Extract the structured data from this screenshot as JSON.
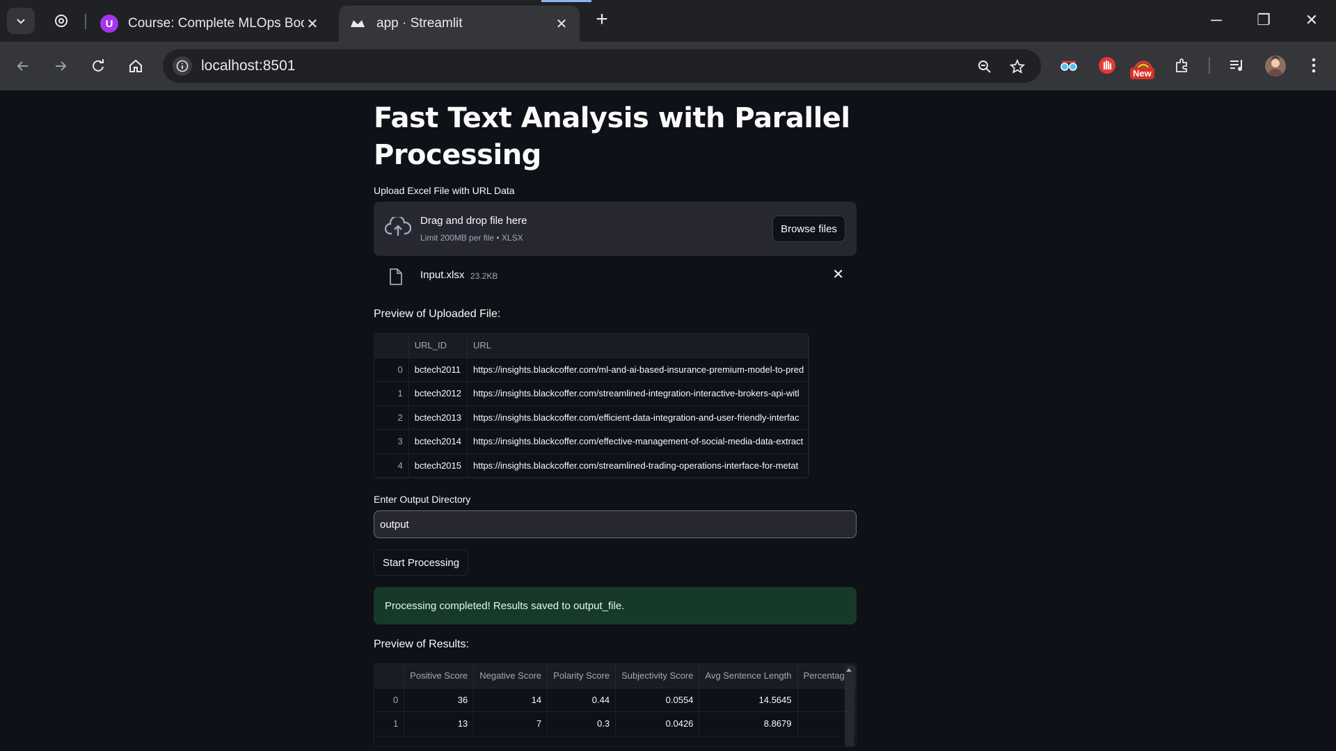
{
  "browser": {
    "tabs": [
      {
        "title": "Course: Complete MLOps Bootc",
        "favicon": "udemy-icon"
      },
      {
        "title": "app · Streamlit",
        "favicon": "streamlit-icon"
      }
    ],
    "address": "localhost:8501",
    "extensions": [
      "new-badge-extension"
    ],
    "new_badge": "New"
  },
  "page": {
    "title": "Fast Text Analysis with Parallel Processing",
    "upload_label": "Upload Excel File with URL Data",
    "dropzone": {
      "main": "Drag and drop file here",
      "sub": "Limit 200MB per file • XLSX",
      "browse": "Browse files"
    },
    "file": {
      "name": "Input.xlsx",
      "size": "23.2KB"
    },
    "preview_heading": "Preview of Uploaded File:",
    "preview_table": {
      "columns": [
        "",
        "URL_ID",
        "URL"
      ],
      "rows": [
        [
          "0",
          "bctech2011",
          "https://insights.blackcoffer.com/ml-and-ai-based-insurance-premium-model-to-pred"
        ],
        [
          "1",
          "bctech2012",
          "https://insights.blackcoffer.com/streamlined-integration-interactive-brokers-api-witl"
        ],
        [
          "2",
          "bctech2013",
          "https://insights.blackcoffer.com/efficient-data-integration-and-user-friendly-interfac"
        ],
        [
          "3",
          "bctech2014",
          "https://insights.blackcoffer.com/effective-management-of-social-media-data-extract"
        ],
        [
          "4",
          "bctech2015",
          "https://insights.blackcoffer.com/streamlined-trading-operations-interface-for-metat"
        ]
      ]
    },
    "output_label": "Enter Output Directory",
    "output_value": "output",
    "start_button": "Start Processing",
    "success_message": "Processing completed! Results saved to output_file.",
    "results_heading": "Preview of Results:",
    "results_table": {
      "columns": [
        "",
        "Positive Score",
        "Negative Score",
        "Polarity Score",
        "Subjectivity Score",
        "Avg Sentence Length",
        "Percentage"
      ],
      "rows": [
        [
          "0",
          "36",
          "14",
          "0.44",
          "0.0554",
          "14.5645",
          ""
        ],
        [
          "1",
          "13",
          "7",
          "0.3",
          "0.0426",
          "8.8679",
          ""
        ]
      ]
    }
  },
  "colors": {
    "background": "#0e1117",
    "widget": "#262730",
    "success_bg": "#173928",
    "success_text": "#dffde9"
  }
}
